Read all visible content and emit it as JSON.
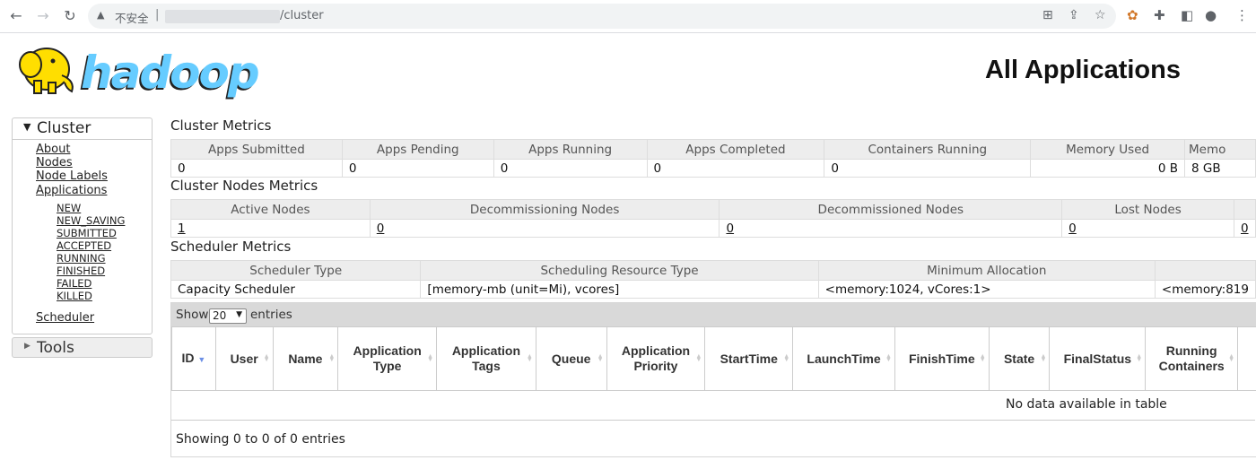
{
  "browser": {
    "insecure_label": "不安全",
    "separator": "|",
    "url_path": "/cluster"
  },
  "header": {
    "logo_text": "hadoop",
    "title": "All Applications"
  },
  "sidebar": {
    "cluster_label": "Cluster",
    "links": [
      "About",
      "Nodes",
      "Node Labels",
      "Applications"
    ],
    "app_states": [
      "NEW",
      "NEW_SAVING",
      "SUBMITTED",
      "ACCEPTED",
      "RUNNING",
      "FINISHED",
      "FAILED",
      "KILLED"
    ],
    "scheduler_link": "Scheduler",
    "tools_label": "Tools"
  },
  "cluster_metrics": {
    "title": "Cluster Metrics",
    "headers": [
      "Apps Submitted",
      "Apps Pending",
      "Apps Running",
      "Apps Completed",
      "Containers Running",
      "Memory Used",
      "Memo"
    ],
    "values": [
      "0",
      "0",
      "0",
      "0",
      "0",
      "0 B",
      "8 GB"
    ]
  },
  "cluster_nodes_metrics": {
    "title": "Cluster Nodes Metrics",
    "headers": [
      "Active Nodes",
      "Decommissioning Nodes",
      "Decommissioned Nodes",
      "Lost Nodes",
      ""
    ],
    "values": [
      "1",
      "0",
      "0",
      "0",
      "0"
    ]
  },
  "scheduler_metrics": {
    "title": "Scheduler Metrics",
    "headers": [
      "Scheduler Type",
      "Scheduling Resource Type",
      "Minimum Allocation",
      ""
    ],
    "values": [
      "Capacity Scheduler",
      "[memory-mb (unit=Mi), vcores]",
      "<memory:1024, vCores:1>",
      "<memory:819"
    ]
  },
  "apps_table": {
    "show_label": "Show",
    "page_length": "20",
    "entries_label": "entries",
    "columns": [
      "ID",
      "User",
      "Name",
      "Application Type",
      "Application Tags",
      "Queue",
      "Application Priority",
      "StartTime",
      "LaunchTime",
      "FinishTime",
      "State",
      "FinalStatus",
      "Running Containers",
      ""
    ],
    "empty_message": "No data available in table",
    "info": "Showing 0 to 0 of 0 entries"
  },
  "colors": {
    "logo_yellow": "#ffde00",
    "logo_blue": "#66ccff",
    "sort_active": "#6c8fe6"
  }
}
